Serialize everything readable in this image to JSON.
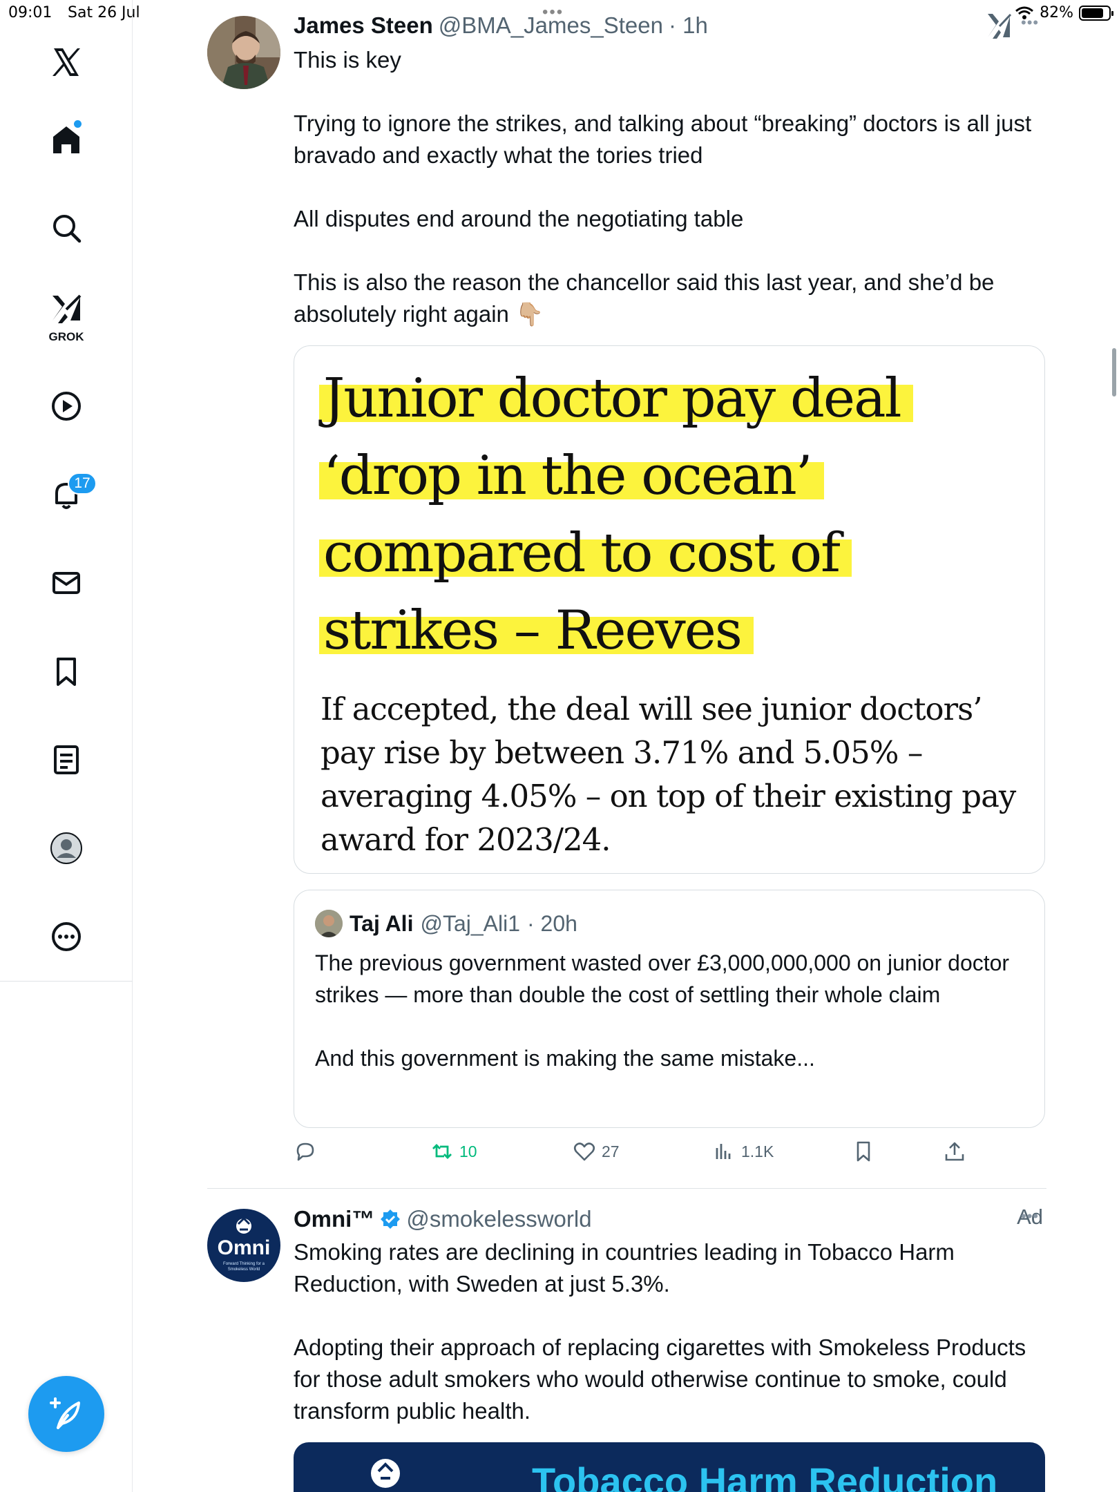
{
  "status_bar": {
    "time": "09:01",
    "date": "Sat 26 Jul",
    "battery_percent": "82%",
    "battery_level": 0.82
  },
  "sidebar": {
    "grok_label": "GROK",
    "notification_count": "17",
    "items": [
      {
        "icon": "x-logo-icon"
      },
      {
        "icon": "home-icon"
      },
      {
        "icon": "search-icon"
      },
      {
        "icon": "grok-icon"
      },
      {
        "icon": "video-icon"
      },
      {
        "icon": "bell-icon"
      },
      {
        "icon": "mail-icon"
      },
      {
        "icon": "bookmark-icon"
      },
      {
        "icon": "list-icon"
      },
      {
        "icon": "profile-icon"
      },
      {
        "icon": "more-icon"
      }
    ]
  },
  "tweet1": {
    "name": "James Steen",
    "handle": "@BMA_James_Steen",
    "time": "· 1h",
    "text": "This is key\n\nTrying to ignore the strikes, and talking about “breaking” doctors is all just bravado and exactly what the tories tried\n\nAll disputes end around the negotiating table\n\nThis is also the reason the chancellor said this last year, and she’d be absolutely right again 👇🏼",
    "image": {
      "headline_lines": [
        "Junior doctor pay deal",
        "‘drop in the ocean’",
        "compared to cost of",
        "strikes – Reeves"
      ],
      "subtext": "If accepted, the deal will see junior doctors’ pay rise by between 3.71% and 5.05% – averaging 4.05% – on top of their existing pay award for 2023/24."
    },
    "quote": {
      "name": "Taj Ali",
      "handle": "@Taj_Ali1",
      "time": "· 20h",
      "text": "The previous government wasted over £3,000,000,000 on junior doctor strikes — more than double the cost of settling their whole claim\n\nAnd this government is making the same mistake..."
    },
    "actions": {
      "retweets": "10",
      "likes": "27",
      "views": "1.1K"
    }
  },
  "tweet2": {
    "name": "Omni™",
    "handle": "@smokelessworld",
    "ad_label": "Ad",
    "text": "Smoking rates are declining in countries leading in Tobacco Harm Reduction, with Sweden at just 5.3%.\n\nAdopting their approach of replacing cigarettes with Smokeless Products for those adult smokers who would otherwise continue to smoke, could transform public health.",
    "avatar_text": "Omni",
    "avatar_tagline": "Forward Thinking for a Smokeless World",
    "banner_text": "Tobacco Harm Reduction"
  },
  "colors": {
    "accent": "#1d9bf0",
    "retweet_green": "#00ba7c",
    "highlight_yellow": "#fcf33d",
    "omni_navy": "#0c2a5c",
    "omni_cyan": "#2cc3f0"
  }
}
